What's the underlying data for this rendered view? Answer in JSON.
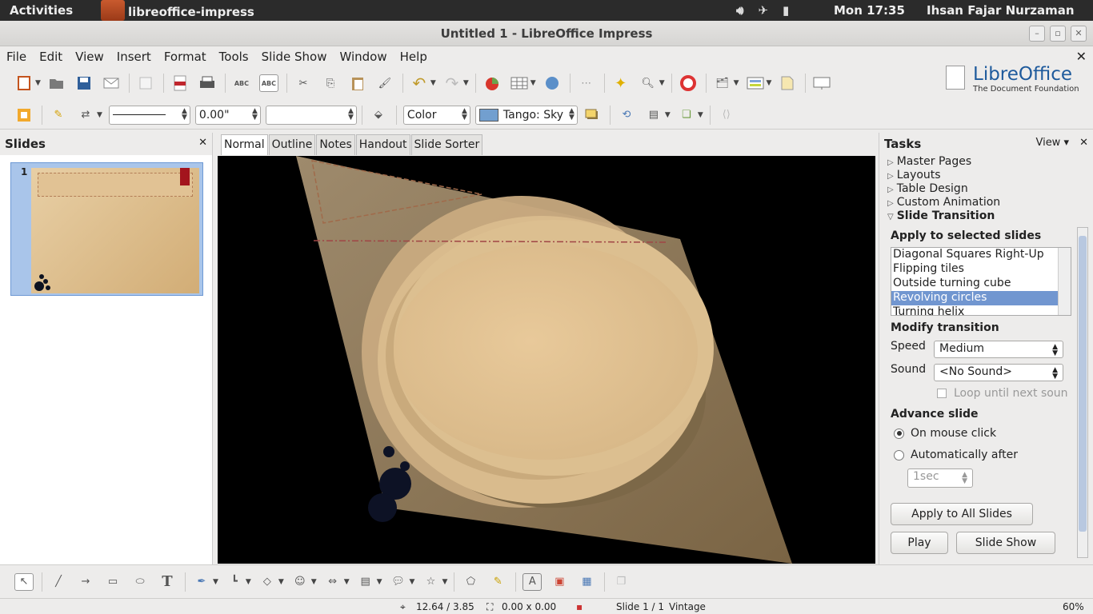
{
  "topbar": {
    "activities": "Activities",
    "app_name": "libreoffice-impress",
    "clock": "Mon 17:35",
    "user": "Ihsan Fajar Nurzaman"
  },
  "window": {
    "title": "Untitled 1 - LibreOffice Impress"
  },
  "menubar": {
    "items": [
      "File",
      "Edit",
      "View",
      "Insert",
      "Format",
      "Tools",
      "Slide Show",
      "Window",
      "Help"
    ]
  },
  "logo": {
    "name": "LibreOffice",
    "tagline": "The Document Foundation"
  },
  "format_toolbar": {
    "line_width": "0.00\"",
    "area_style": "Color",
    "area_color": "Tango: Sky"
  },
  "slides_pane": {
    "title": "Slides",
    "slides": [
      {
        "number": "1"
      }
    ]
  },
  "view_tabs": [
    "Normal",
    "Outline",
    "Notes",
    "Handout",
    "Slide Sorter"
  ],
  "tasks_pane": {
    "title": "Tasks",
    "view_label": "View",
    "sections": [
      "Master Pages",
      "Layouts",
      "Table Design",
      "Custom Animation"
    ],
    "open_section": "Slide Transition",
    "apply_title": "Apply to selected slides",
    "effects": [
      "Diagonal Squares Right-Up",
      "Flipping tiles",
      "Outside turning cube",
      "Revolving circles",
      "Turning helix"
    ],
    "selected_effect_index": 3,
    "modify_title": "Modify transition",
    "speed_label": "Speed",
    "speed_value": "Medium",
    "sound_label": "Sound",
    "sound_value": "<No Sound>",
    "loop_label": "Loop until next soun",
    "advance_title": "Advance slide",
    "on_mouse_click": "On mouse click",
    "automatically_after": "Automatically after",
    "auto_time": "1sec",
    "apply_all_button": "Apply to All Slides",
    "play_button": "Play",
    "slideshow_button": "Slide Show"
  },
  "statusbar": {
    "position": "12.64 / 3.85",
    "size": "0.00 x 0.00",
    "slide": "Slide 1 / 1",
    "master": "Vintage",
    "zoom": "60%"
  },
  "colors": {
    "selection": "#7196d0",
    "canvas_bg": "#000000",
    "slide_tan": "#e0c393"
  }
}
